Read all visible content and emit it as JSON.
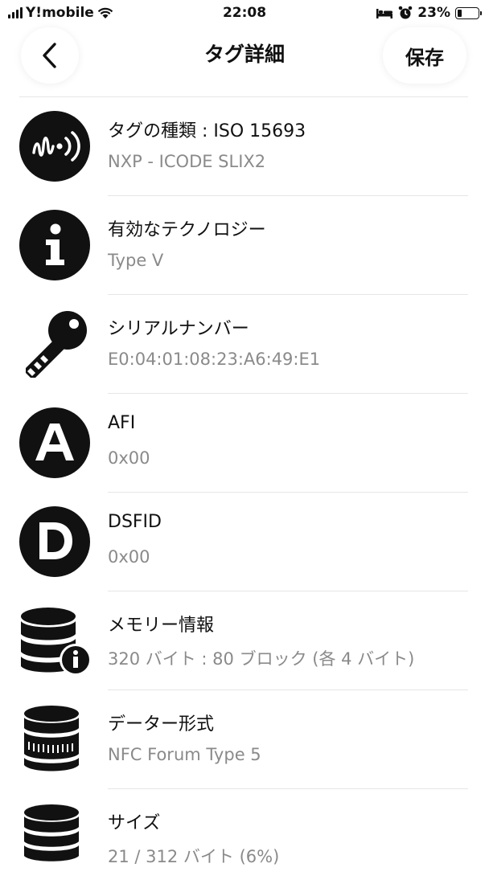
{
  "status_bar": {
    "carrier": "Y!mobile",
    "time": "22:08",
    "battery": "23%",
    "battery_level": 0.23
  },
  "nav": {
    "title": "タグ詳細",
    "save_label": "保存"
  },
  "details": [
    {
      "icon": "nfc-wave-icon",
      "label": "タグの種類 : ISO 15693",
      "value": "NXP - ICODE SLIX2"
    },
    {
      "icon": "info-icon",
      "label": "有効なテクノロジー",
      "value": "Type V"
    },
    {
      "icon": "key-icon",
      "label": "シリアルナンバー",
      "value": "E0:04:01:08:23:A6:49:E1"
    },
    {
      "icon": "letter-a-icon",
      "label": "AFI",
      "value": "0x00"
    },
    {
      "icon": "letter-d-icon",
      "label": "DSFID",
      "value": "0x00"
    },
    {
      "icon": "database-info-icon",
      "label": "メモリー情報",
      "value": "320 バイト : 80 ブロック (各 4 バイト)"
    },
    {
      "icon": "database-format-icon",
      "label": "データー形式",
      "value": "NFC Forum Type 5"
    },
    {
      "icon": "database-size-icon",
      "label": "サイズ",
      "value": "21 / 312 バイト (6%)"
    }
  ]
}
